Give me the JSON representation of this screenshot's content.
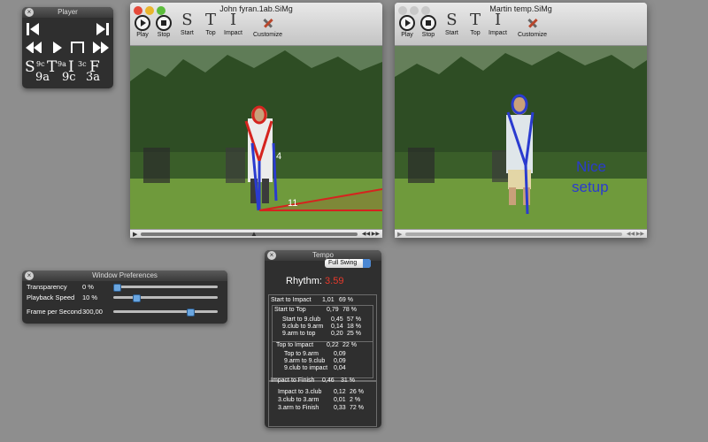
{
  "player": {
    "title": "Player",
    "letters": [
      "S",
      "T",
      "I",
      "F"
    ],
    "sup_top": [
      "9c",
      "9a",
      "3c"
    ],
    "sub": [
      "9a",
      "9c",
      "3a"
    ]
  },
  "window_left": {
    "title": "John fyran.1ab.SiMg",
    "toolbar": {
      "play": "Play",
      "stop": "Stop",
      "start": "Start",
      "top": "Top",
      "impact": "Impact",
      "customize": "Customize"
    },
    "letters": {
      "start": "S",
      "top": "T",
      "impact": "I"
    },
    "overlay_labels": {
      "a": "4",
      "b": "11"
    }
  },
  "window_right": {
    "title": "Martin temp.SiMg",
    "toolbar": {
      "play": "Play",
      "stop": "Stop",
      "start": "Start",
      "top": "Top",
      "impact": "Impact",
      "customize": "Customize"
    },
    "letters": {
      "start": "S",
      "top": "T",
      "impact": "I"
    },
    "annotation_line1": "Nice",
    "annotation_line2": "setup"
  },
  "prefs": {
    "title": "Window Preferences",
    "rows": [
      {
        "label": "Transparency",
        "value": "0 %",
        "level": 0.0
      },
      {
        "label": "Playback Speed",
        "value": "10 %",
        "level": 0.2
      },
      {
        "label": "Frame per Second",
        "value": "300,00",
        "level": 0.75
      }
    ]
  },
  "tempo": {
    "title": "Tempo",
    "mode": "Full Swing",
    "rhythm_label": "Rhythm:",
    "rhythm_value": "3.59",
    "rhythm_color": "#e8392b",
    "lines": [
      {
        "label": "Start to Impact",
        "v1": "1,01",
        "v2": "69 %"
      },
      {
        "label": "Start to Top",
        "v1": "0,79",
        "v2": "78 %"
      },
      {
        "label": "Start to 9.club",
        "v1": "0,45",
        "v2": "57 %"
      },
      {
        "label": "9.club to 9.arm",
        "v1": "0,14",
        "v2": "18 %"
      },
      {
        "label": "9.arm to top",
        "v1": "0,20",
        "v2": "25 %"
      },
      {
        "label": "Top to Impact",
        "v1": "0,22",
        "v2": "22 %"
      },
      {
        "label": "Top to 9.arm",
        "v1": "0,09",
        "v2": ""
      },
      {
        "label": "9.arm to 9.club",
        "v1": "0,09",
        "v2": ""
      },
      {
        "label": "9.club to impact",
        "v1": "0,04",
        "v2": ""
      },
      {
        "label": "Impact to Finish",
        "v1": "0,46",
        "v2": "31 %"
      },
      {
        "label": "Impact to 3.club",
        "v1": "0,12",
        "v2": "26 %"
      },
      {
        "label": "3.club to 3.arm",
        "v1": "0,01",
        "v2": "2 %"
      },
      {
        "label": "3.arm to Finish",
        "v1": "0,33",
        "v2": "72 %"
      }
    ]
  }
}
